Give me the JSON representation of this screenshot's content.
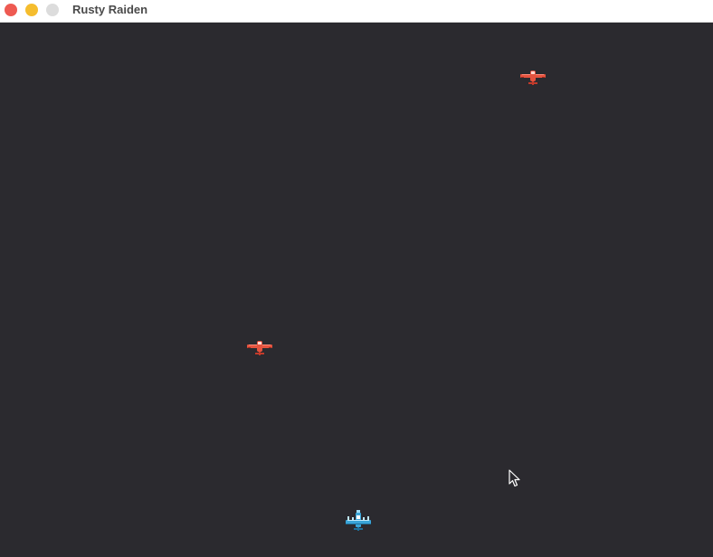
{
  "window": {
    "title": "Rusty Raiden",
    "controls": {
      "close_color": "#ee5a52",
      "minimize_color": "#f5bd2e",
      "zoom_color": "#dcdcdc"
    }
  },
  "game": {
    "background_color": "#2b2a2f",
    "enemies": [
      {
        "name": "red-enemy-plane",
        "color": "#e5533f"
      },
      {
        "name": "red-enemy-plane",
        "color": "#e5533f"
      }
    ],
    "player": {
      "name": "blue-player-fighter",
      "color": "#3aa5d8"
    },
    "cursor_icon": "mouse-pointer-icon"
  }
}
